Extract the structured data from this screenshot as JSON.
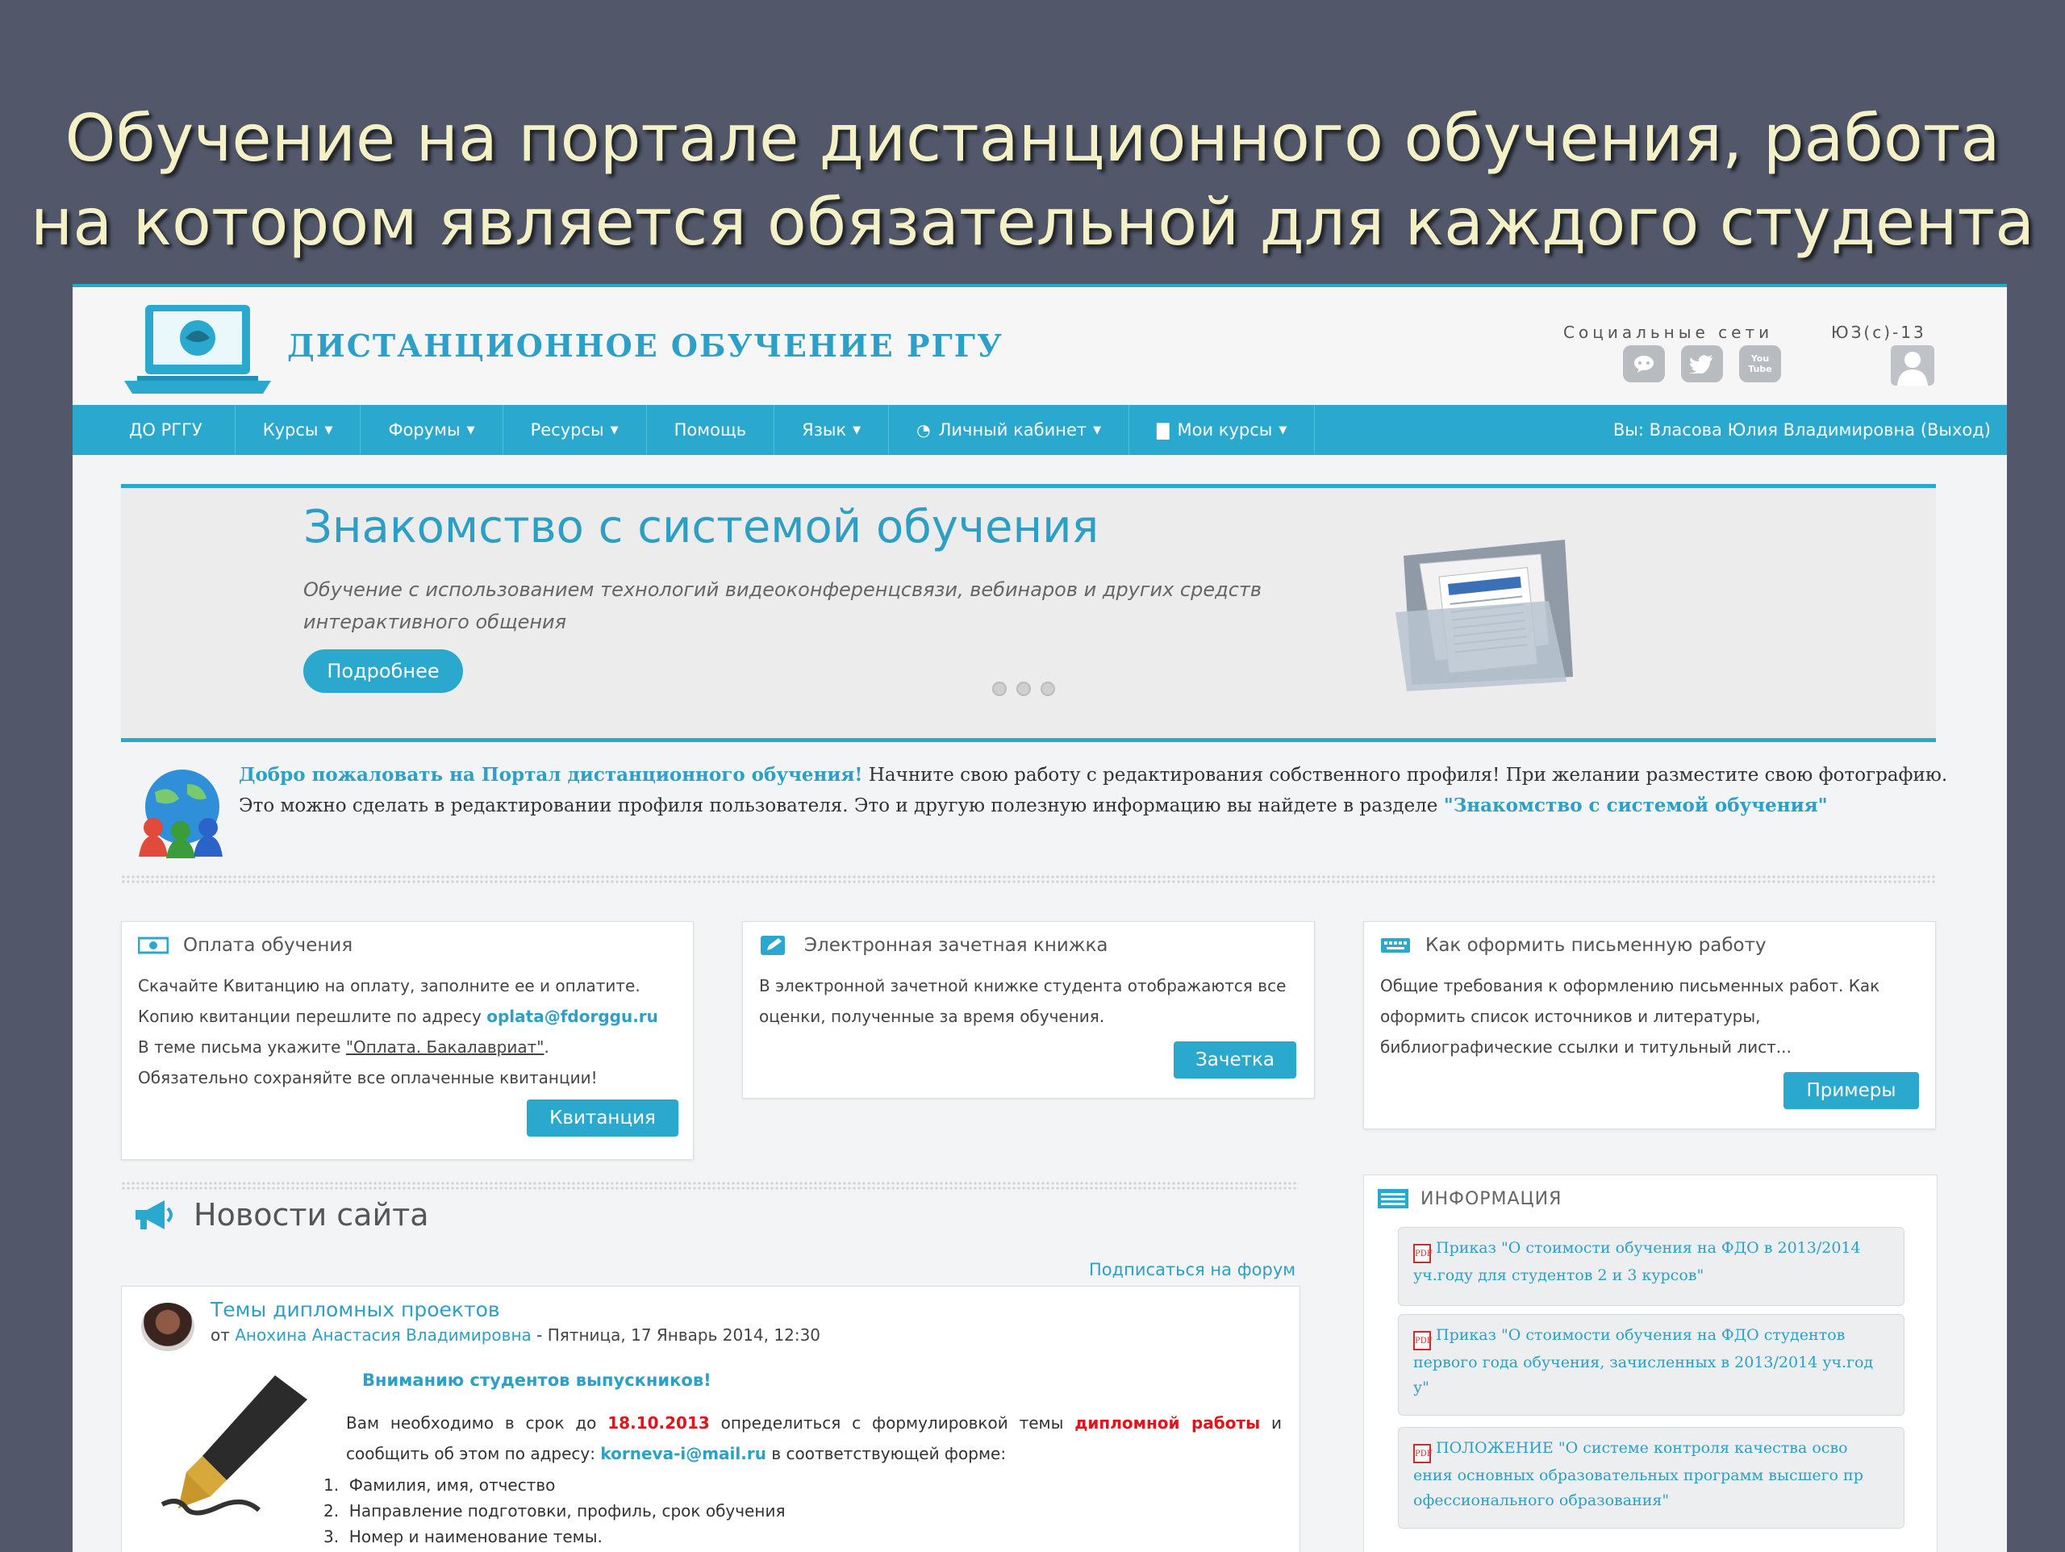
{
  "slide": {
    "title_line1": "Обучение на портале дистанционного обучения, работа",
    "title_line2": "на котором является обязательной для каждого студента"
  },
  "header": {
    "site_name": "ДИСТАНЦИОННОЕ ОБУЧЕНИЕ РГГУ",
    "social_label": "Социальные сети",
    "user_code": "ЮЗ(с)-13",
    "social_icons": [
      "chat-icon",
      "twitter-icon",
      "youtube-icon"
    ],
    "youtube_text": "You Tube"
  },
  "nav": {
    "home": "ДО РГГУ",
    "courses": "Курсы",
    "forums": "Форумы",
    "resources": "Ресурсы",
    "help": "Помощь",
    "language": "Язык",
    "cabinet": "Личный кабинет",
    "my_courses": "Мои курсы",
    "user": "Вы: Власова Юлия Владимировна (Выход)"
  },
  "carousel": {
    "title": "Знакомство с системой обучения",
    "text": "Обучение с использованием технологий видеоконференцсвязи, вебинаров и других средств интерактивного общения",
    "button": "Подробнее"
  },
  "welcome": {
    "bold": "Добро пожаловать на Портал дистанционного обучения!",
    "text": " Начните свою работу с редактирования собственного профиля! При желании разместите свою фотографию. Это можно сделать в редактировании профиля пользователя. Это и другую полезную информацию вы найдете в разделе ",
    "link": "\"Знакомство с системой обучения\""
  },
  "cards": {
    "payment": {
      "title": "Оплата обучения",
      "line1": "Скачайте Квитанцию на оплату, заполните ее и оплатите.",
      "line2": "Копию квитанции перешлите по адресу ",
      "email": "oplata@fdorggu.ru",
      "line3a": "В теме письма укажите ",
      "subject": "\"Оплата. Бакалавриат\"",
      "line3b": ".",
      "line4": "Обязательно сохраняйте все оплаченные квитанции!",
      "button": "Квитанция"
    },
    "gradebook": {
      "title": "Электронная зачетная книжка",
      "line1": "В электронной зачетной книжке студента отображаются все",
      "line2": "оценки, полученные за время обучения.",
      "button": "Зачетка"
    },
    "written": {
      "title": "Как оформить письменную работу",
      "line1": "Общие требования к оформлению письменных работ. Как",
      "line2": "оформить список источников и литературы,",
      "line3": "библиографические ссылки и титульный лист...",
      "button": "Примеры"
    }
  },
  "news": {
    "title": "Новости сайта",
    "subscribe": "Подписаться на форум",
    "post": {
      "title": "Темы дипломных проектов",
      "by": "от ",
      "author": "Анохина Анастасия Владимировна",
      "date": " - Пятница, 17 Январь 2014, 12:30",
      "alert": "Вниманию студентов выпускников!",
      "body1": "Вам необходимо в срок до ",
      "deadline": "18.10.2013",
      "body2": " определиться с формулировкой темы ",
      "thesis": "дипломной работы",
      "body3": " и сообщить об этом по адресу: ",
      "email": "korneva-i@mail.ru",
      "body4": " в соответствующей форме:",
      "list": [
        "Фамилия, имя, отчество",
        "Направление подготовки, профиль, срок обучения",
        "Номер и наименование темы."
      ]
    }
  },
  "info": {
    "title": "ИНФОРМАЦИЯ",
    "items": [
      "Приказ \"О стоимости обучения на ФДО в 2013/2014 уч.году для студентов 2 и 3 курсов\"",
      "Приказ \"О стоимости обучения на ФДО студентов первого года обучения, зачисленных в 2013/2014 уч.год у\"",
      "ПОЛОЖЕНИЕ \"О системе контроля качества осво ения основных образовательных программ высшего пр офессионального образования\""
    ]
  },
  "colors": {
    "accent": "#2aa8cd",
    "slide_bg": "#52586a",
    "title_text": "#f4f1c6",
    "deadline_red": "#e0141c"
  }
}
